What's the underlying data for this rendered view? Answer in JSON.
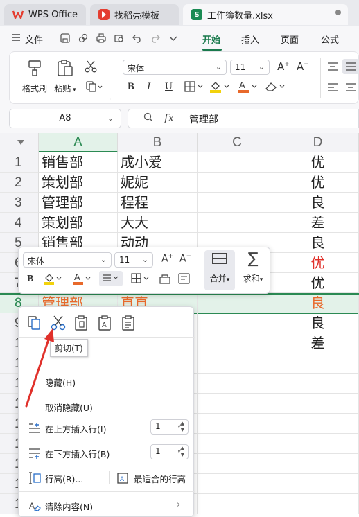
{
  "tabs": [
    {
      "label": "WPS Office",
      "icon": "wps-logo-icon",
      "color": "#e43d30"
    },
    {
      "label": "找稻壳模板",
      "icon": "docer-logo-icon",
      "color": "#e43d30"
    },
    {
      "label": "工作簿数量.xlsx",
      "icon": "spreadsheet-icon",
      "color": "#1a8a53"
    }
  ],
  "menu": {
    "file": "文件",
    "items": [
      "开始",
      "插入",
      "页面",
      "公式"
    ],
    "active": "开始"
  },
  "ribbon": {
    "format_painter": "格式刷",
    "paste": "粘贴",
    "font_name": "宋体",
    "font_size": "11",
    "bold": "B",
    "italic": "I",
    "underline": "U"
  },
  "formula_bar": {
    "cell_ref": "A8",
    "fx": "fx",
    "value": "管理部"
  },
  "columns": [
    "A",
    "B",
    "C",
    "D"
  ],
  "rows": [
    {
      "num": "1",
      "a": "销售部",
      "b": "成小爱",
      "d": "优"
    },
    {
      "num": "2",
      "a": "策划部",
      "b": "妮妮",
      "d": "优"
    },
    {
      "num": "3",
      "a": "管理部",
      "b": "程程",
      "d": "良"
    },
    {
      "num": "4",
      "a": "策划部",
      "b": "大大",
      "d": "差"
    },
    {
      "num": "5",
      "a": "销售部",
      "b": "动动",
      "d": "良"
    },
    {
      "num": "6",
      "a": "",
      "b": "",
      "d": "优"
    },
    {
      "num": "7",
      "a": "",
      "b": "",
      "d": "优"
    },
    {
      "num": "8",
      "a": "管理部",
      "b": "直直",
      "d": "良"
    },
    {
      "num": "9",
      "a": "",
      "b": "",
      "d": "良"
    },
    {
      "num": "1",
      "a": "",
      "b": "",
      "d": "差"
    },
    {
      "num": "1",
      "a": "",
      "b": "",
      "d": ""
    },
    {
      "num": "1",
      "a": "",
      "b": "",
      "d": ""
    },
    {
      "num": "1",
      "a": "",
      "b": "",
      "d": ""
    },
    {
      "num": "1",
      "a": "",
      "b": "",
      "d": ""
    },
    {
      "num": "1",
      "a": "",
      "b": "",
      "d": ""
    },
    {
      "num": "1",
      "a": "",
      "b": "",
      "d": ""
    },
    {
      "num": "1",
      "a": "",
      "b": "",
      "d": ""
    },
    {
      "num": "1",
      "a": "",
      "b": "",
      "d": ""
    }
  ],
  "mini_toolbar": {
    "font_name": "宋体",
    "font_size": "11",
    "bold": "B",
    "merge": "合并",
    "sum": "求和"
  },
  "context_menu": {
    "tooltip": "剪切(T)",
    "hide": "隐藏(H)",
    "unhide": "取消隐藏(U)",
    "insert_above": "在上方插入行(I)",
    "insert_above_count": "1",
    "insert_below": "在下方插入行(B)",
    "insert_below_count": "1",
    "row_height": "行高(R)...",
    "best_fit": "最适合的行高",
    "clear": "清除内容(N)"
  },
  "colors": {
    "accent": "#1a7a4d",
    "red": "#e0302a",
    "orange": "#e8692b",
    "selection": "#e3f2e9"
  }
}
